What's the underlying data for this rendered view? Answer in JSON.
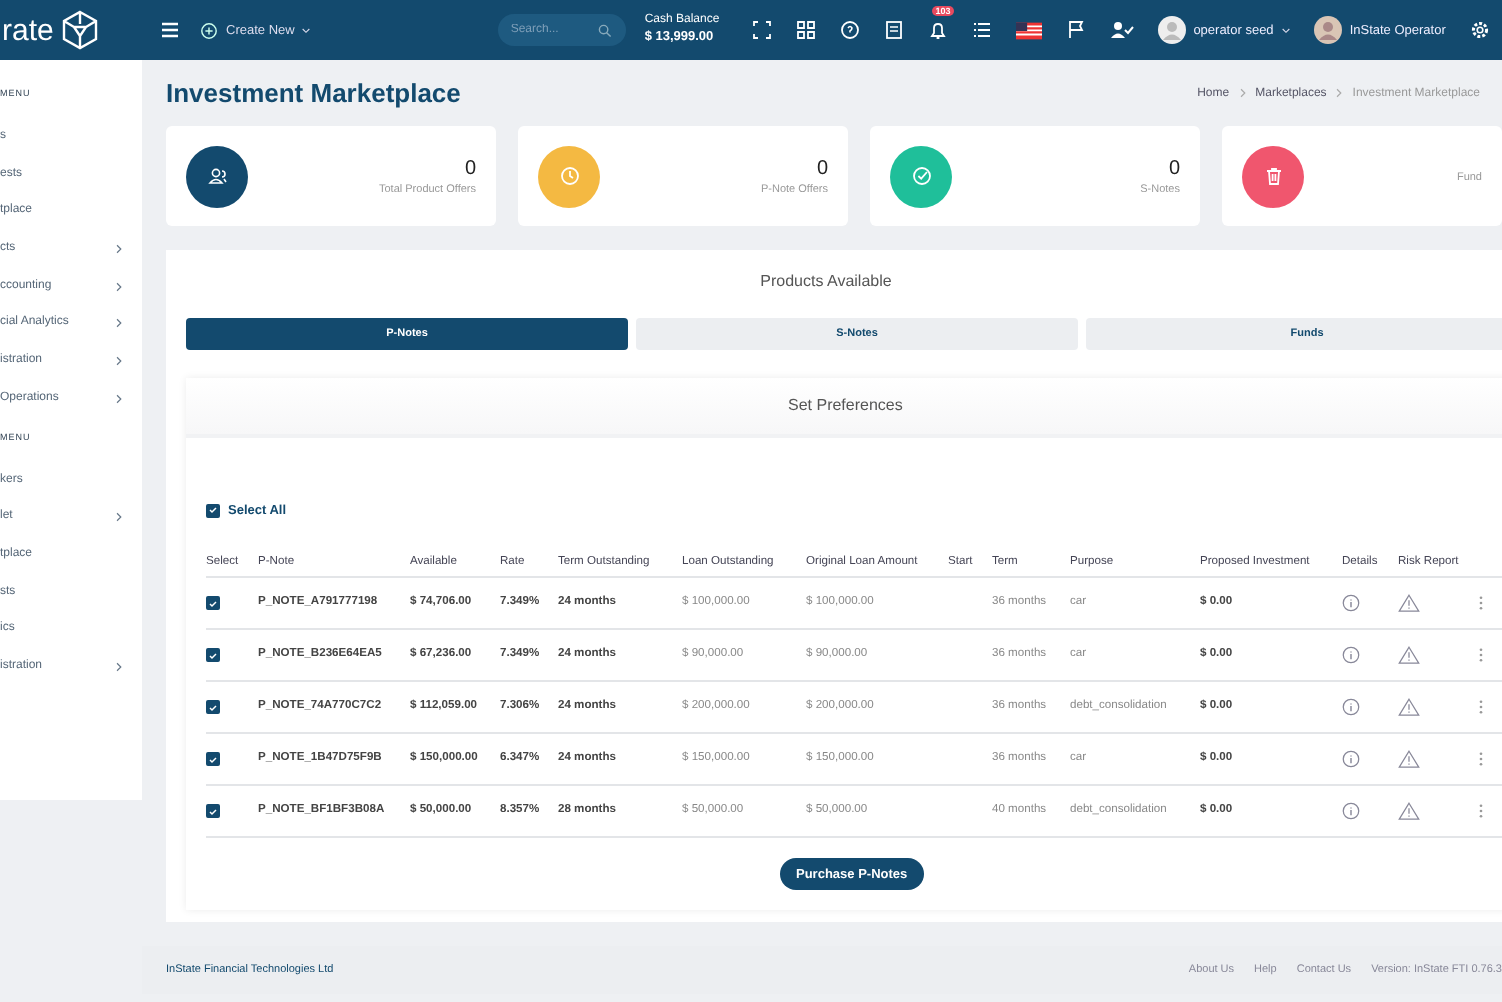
{
  "header": {
    "logo": "rate",
    "create_new": "Create New",
    "search": {
      "placeholder": "Search..."
    },
    "cash_balance_label": "Cash Balance",
    "cash_balance": "$ 13,999.00",
    "notification_count": "103",
    "user": "operator seed",
    "operator": "InState Operator"
  },
  "sidebar": {
    "items": [
      {
        "label": "MENU",
        "kind": "heading"
      },
      {
        "label": "s",
        "kind": "item"
      },
      {
        "label": "ests",
        "kind": "item"
      },
      {
        "label": "tplace",
        "kind": "item"
      },
      {
        "label": "cts",
        "kind": "group"
      },
      {
        "label": "ccounting",
        "kind": "group"
      },
      {
        "label": "cial Analytics",
        "kind": "group"
      },
      {
        "label": "istration",
        "kind": "group"
      },
      {
        "label": "Operations",
        "kind": "group"
      },
      {
        "label": "MENU",
        "kind": "heading"
      },
      {
        "label": "kers",
        "kind": "item"
      },
      {
        "label": "let",
        "kind": "group"
      },
      {
        "label": "tplace",
        "kind": "item"
      },
      {
        "label": "sts",
        "kind": "item"
      },
      {
        "label": "ics",
        "kind": "item"
      },
      {
        "label": "istration",
        "kind": "group"
      }
    ]
  },
  "page_title": "Investment Marketplace",
  "breadcrumbs": [
    "Home",
    "Marketplaces",
    "Investment Marketplace"
  ],
  "stats": [
    {
      "value": "0",
      "label": "Total Product Offers",
      "color": "#134a6e",
      "kind": "users"
    },
    {
      "value": "0",
      "label": "P-Note Offers",
      "color": "#f4b942",
      "kind": "clock"
    },
    {
      "value": "0",
      "label": "S-Notes",
      "color": "#1fbf9a",
      "kind": "check"
    },
    {
      "label": "Fund",
      "color": "#f0566e",
      "kind": "trash"
    }
  ],
  "products_title": "Products Available",
  "tabs": [
    {
      "label": "P-Notes",
      "selected": true
    },
    {
      "label": "S-Notes",
      "selected": false
    },
    {
      "label": "Funds",
      "selected": false
    }
  ],
  "preferences_title": "Set Preferences",
  "select_all": {
    "label": "Select All",
    "checked": true
  },
  "table": {
    "columns": [
      "Select",
      "P-Note",
      "Available",
      "Rate",
      "Term Outstanding",
      "Loan Outstanding",
      "Original Loan Amount",
      "Start",
      "Term",
      "Purpose",
      "Proposed Investment",
      "Details",
      "Risk Report"
    ],
    "rows": [
      {
        "checked": true,
        "p_note": "P_NOTE_A791777198",
        "available": "$ 74,706.00",
        "rate": "7.349%",
        "term_outstanding": "24 months",
        "loan_outstanding": "$ 100,000.00",
        "original_loan_amount": "$ 100,000.00",
        "term": "36 months",
        "purpose": "car",
        "proposed_investment": "$ 0.00"
      },
      {
        "checked": true,
        "p_note": "P_NOTE_B236E64EA5",
        "available": "$ 67,236.00",
        "rate": "7.349%",
        "term_outstanding": "24 months",
        "loan_outstanding": "$ 90,000.00",
        "original_loan_amount": "$ 90,000.00",
        "term": "36 months",
        "purpose": "car",
        "proposed_investment": "$ 0.00"
      },
      {
        "checked": true,
        "p_note": "P_NOTE_74A770C7C2",
        "available": "$ 112,059.00",
        "rate": "7.306%",
        "term_outstanding": "24 months",
        "loan_outstanding": "$ 200,000.00",
        "original_loan_amount": "$ 200,000.00",
        "term": "36 months",
        "purpose": "debt_consolidation",
        "proposed_investment": "$ 0.00"
      },
      {
        "checked": true,
        "p_note": "P_NOTE_1B47D75F9B",
        "available": "$ 150,000.00",
        "rate": "6.347%",
        "term_outstanding": "24 months",
        "loan_outstanding": "$ 150,000.00",
        "original_loan_amount": "$ 150,000.00",
        "term": "36 months",
        "purpose": "car",
        "proposed_investment": "$ 0.00"
      },
      {
        "checked": true,
        "p_note": "P_NOTE_BF1BF3B08A",
        "available": "$ 50,000.00",
        "rate": "8.357%",
        "term_outstanding": "28 months",
        "loan_outstanding": "$ 50,000.00",
        "original_loan_amount": "$ 50,000.00",
        "term": "40 months",
        "purpose": "debt_consolidation",
        "proposed_investment": "$ 0.00"
      }
    ]
  },
  "purchase_button": "Purchase P-Notes",
  "footer": {
    "company": "InState Financial Technologies Ltd",
    "links": [
      "About Us",
      "Help",
      "Contact Us"
    ],
    "version": "Version: InState FTI 0.76.3"
  }
}
